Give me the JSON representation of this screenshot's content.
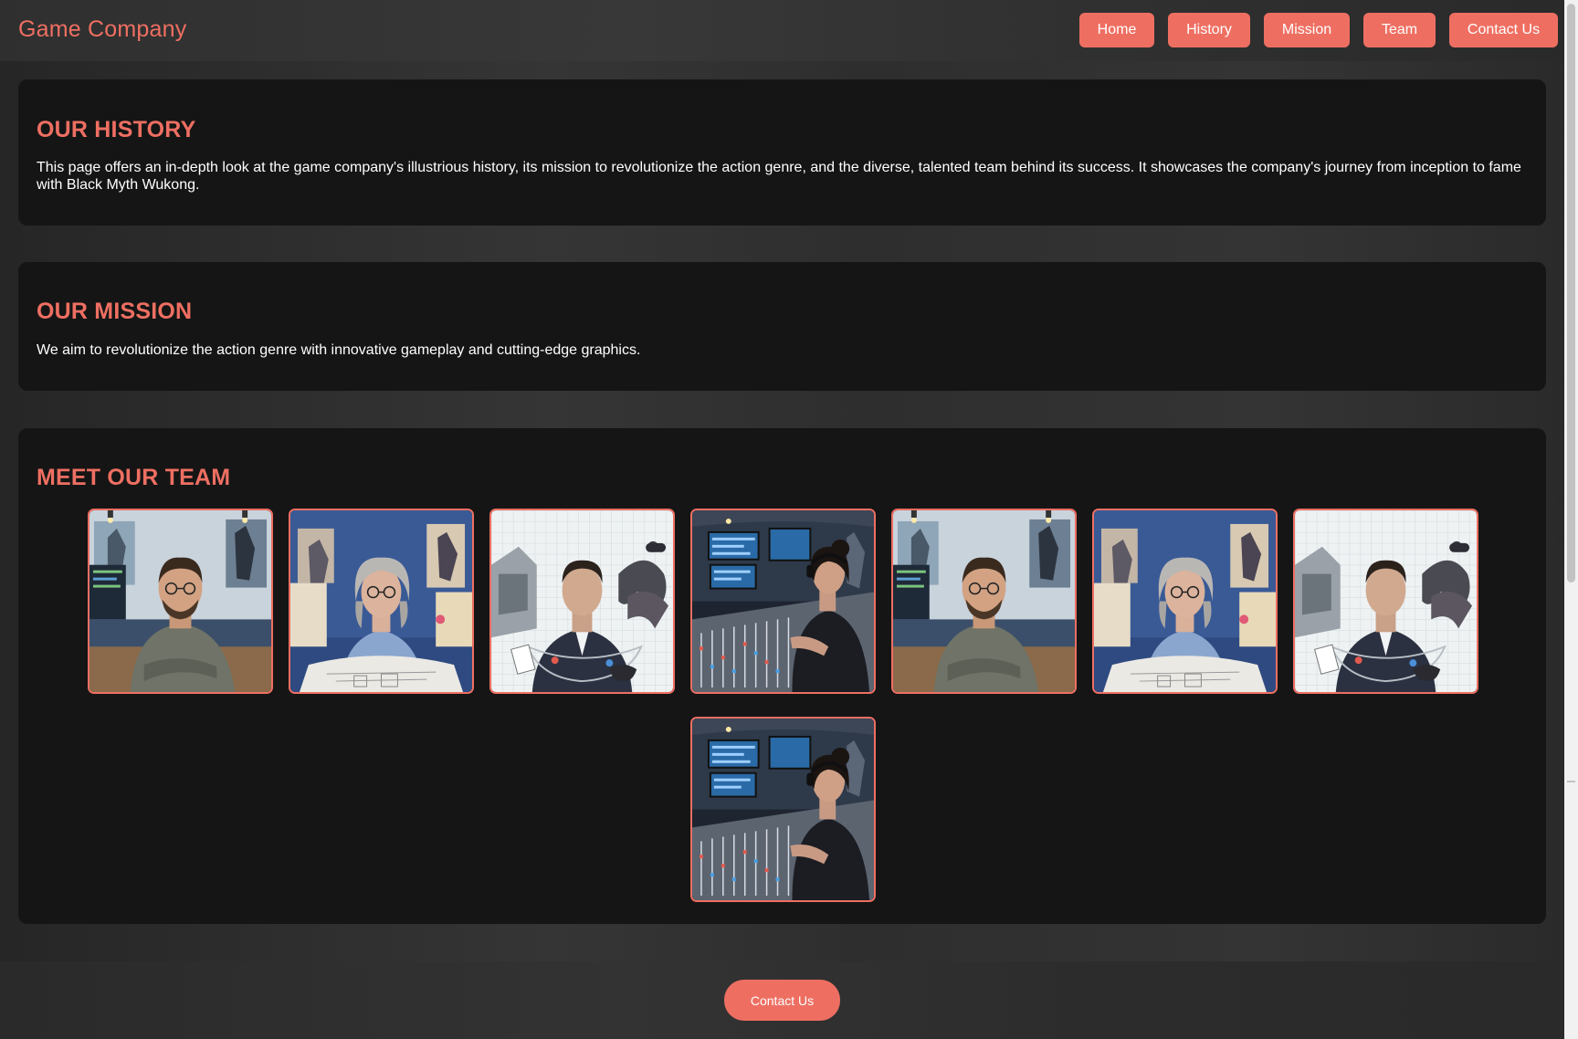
{
  "header": {
    "brand": "Game Company",
    "nav": [
      {
        "label": "Home"
      },
      {
        "label": "History"
      },
      {
        "label": "Mission"
      },
      {
        "label": "Team"
      },
      {
        "label": "Contact Us"
      }
    ]
  },
  "history": {
    "title": "OUR HISTORY",
    "body": "This page offers an in-depth look at the game company's illustrious history, its mission to revolutionize the action genre, and the diverse, talented team behind its success. It showcases the company's journey from inception to fame with Black Myth Wukong."
  },
  "mission": {
    "title": "OUR MISSION",
    "body": "We aim to revolutionize the action genre with innovative gameplay and cutting-edge graphics."
  },
  "team": {
    "title": "MEET OUR TEAM",
    "members": [
      {
        "portrait": "bearded-man-glasses-sweater"
      },
      {
        "portrait": "gray-haired-woman-glasses"
      },
      {
        "portrait": "man-in-suit-dragon"
      },
      {
        "portrait": "woman-sound-engineer"
      },
      {
        "portrait": "bearded-man-glasses-sweater"
      },
      {
        "portrait": "gray-haired-woman-glasses"
      },
      {
        "portrait": "man-in-suit-dragon"
      },
      {
        "portrait": "woman-sound-engineer"
      }
    ]
  },
  "footer": {
    "contact_label": "Contact Us"
  },
  "colors": {
    "accent": "#ee6f62",
    "section_bg": "#151515",
    "page_bg": "#2e2e2e"
  }
}
